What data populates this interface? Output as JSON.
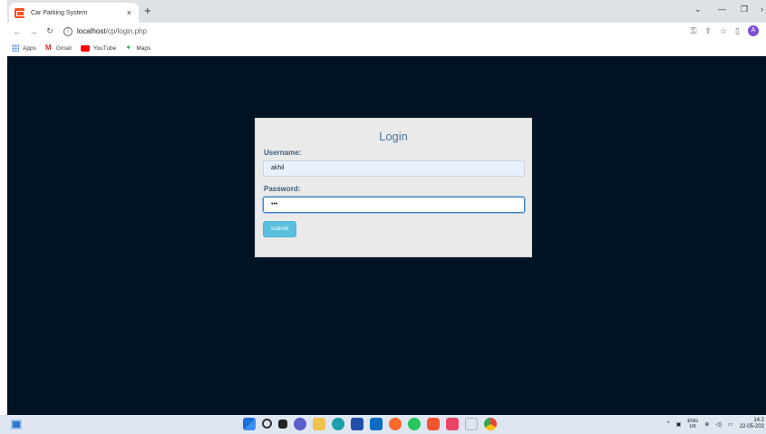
{
  "browser": {
    "tab_title": "Car Parking System",
    "tab_close": "×",
    "new_tab": "+",
    "url_host": "localhost",
    "url_path": "/cp/login.php",
    "bookmarks": [
      "Apps",
      "Gmail",
      "YouTube",
      "Maps"
    ],
    "avatar_letter": "A"
  },
  "login": {
    "title": "Login",
    "username_label": "Username:",
    "username_value": "akhil",
    "password_label": "Password:",
    "password_value": "•••",
    "submit_label": "submit"
  },
  "taskbar": {
    "lang_top": "ENG",
    "lang_bottom": "UK",
    "time": "14:2",
    "date": "22-05-202"
  },
  "colors": {
    "page_bg": "#011423",
    "login_bg": "#eaeaea",
    "title_color": "#4a7aa0",
    "submit_bg": "#5bc0de"
  }
}
